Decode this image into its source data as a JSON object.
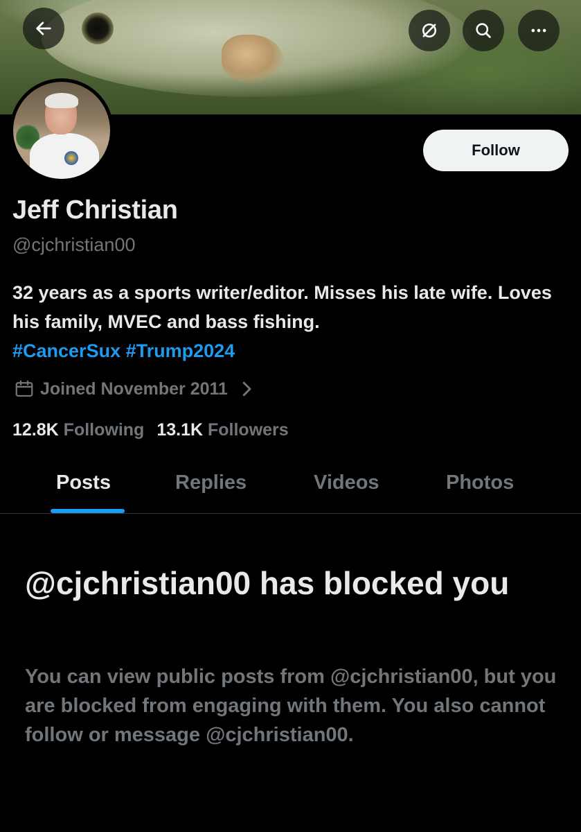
{
  "top_bar": {
    "back_icon": "arrow-left-icon",
    "grok_icon": "grok-icon",
    "search_icon": "search-icon",
    "more_icon": "more-horizontal-icon"
  },
  "profile": {
    "follow_label": "Follow",
    "name": "Jeff Christian",
    "handle": "@cjchristian00",
    "bio_text": "32 years as a sports writer/editor. Misses his late wife. Loves his family, MVEC and bass fishing.",
    "hashtags": [
      "#CancerSux",
      "#Trump2024"
    ],
    "joined": "Joined November 2011",
    "following_count": "12.8K",
    "following_label": "Following",
    "followers_count": "13.1K",
    "followers_label": "Followers"
  },
  "tabs": [
    {
      "label": "Posts",
      "active": true
    },
    {
      "label": "Replies",
      "active": false
    },
    {
      "label": "Videos",
      "active": false
    },
    {
      "label": "Photos",
      "active": false
    }
  ],
  "blocked": {
    "title": "@cjchristian00 has blocked you",
    "description": "You can view public posts from @cjchristian00, but you are blocked from engaging with them. You also cannot follow or message @cjchristian00."
  },
  "colors": {
    "accent": "#1d9bf0",
    "text_primary": "#e7e9ea",
    "text_secondary": "#71767b",
    "background": "#000000"
  }
}
